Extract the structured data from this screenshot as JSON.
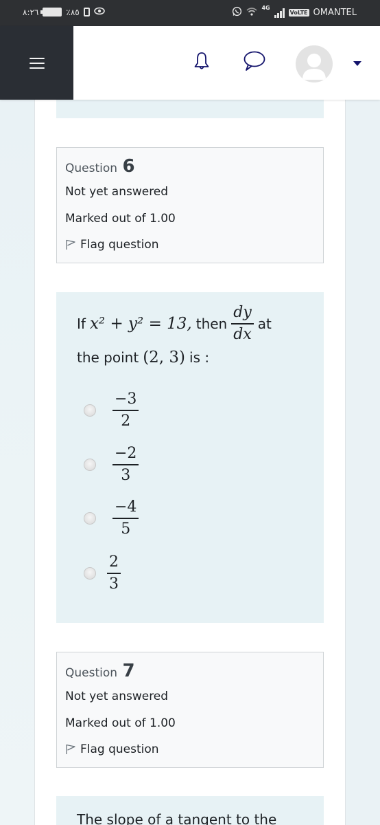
{
  "status_bar": {
    "time": "٨:٢٦",
    "battery_percent": "٪٨٥",
    "network": "4G",
    "volte_label": "VoLTE",
    "carrier": "OMANTEL"
  },
  "header": {
    "menu_icon": "hamburger-icon",
    "notifications_icon": "bell-icon",
    "messages_icon": "chat-bubble-icon",
    "user_icon": "avatar-icon",
    "user_menu_icon": "caret-down-icon"
  },
  "questions": [
    {
      "label": "Question",
      "number": "6",
      "state": "Not yet answered",
      "grade": "Marked out of 1.00",
      "flag_label": "Flag question",
      "text_parts": {
        "if": "If",
        "equation": "x² + y² = 13,",
        "then": "then",
        "frac_num": "dy",
        "frac_den": "dx",
        "at": "at",
        "line2_prefix": "the point",
        "point": "(2, 3)",
        "line2_suffix": "is :"
      },
      "answers": [
        {
          "num": "−3",
          "den": "2",
          "selected": false
        },
        {
          "num": "−2",
          "den": "3",
          "selected": false
        },
        {
          "num": "−4",
          "den": "5",
          "selected": false
        },
        {
          "num": "2",
          "den": "3",
          "selected": false
        }
      ]
    },
    {
      "label": "Question",
      "number": "7",
      "state": "Not yet answered",
      "grade": "Marked out of 1.00",
      "flag_label": "Flag question",
      "text_partial": "The slope of a tangent to the"
    }
  ]
}
